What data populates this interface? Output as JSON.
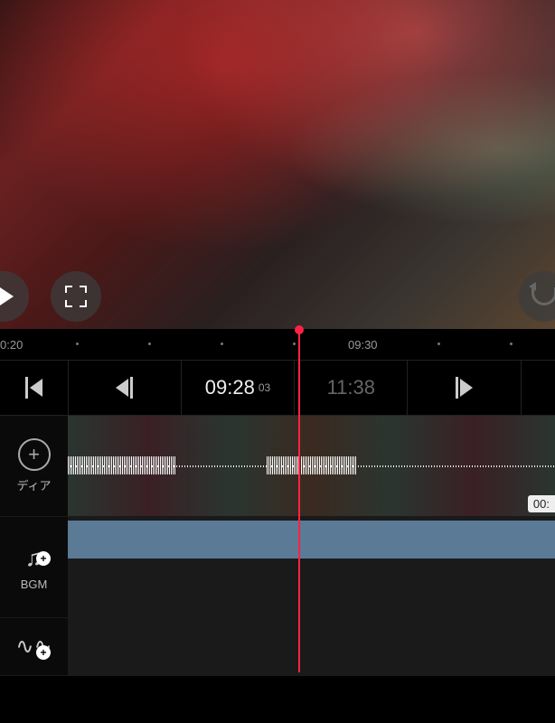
{
  "ruler": {
    "ticks": [
      "0:20",
      "09:30"
    ],
    "tick_positions": [
      0,
      385
    ]
  },
  "transport": {
    "current_time": "09:28",
    "current_frame": "03",
    "total_time": "11:38"
  },
  "tracks": {
    "media": {
      "label": "ディア",
      "clip_end_label": "00:"
    },
    "bgm": {
      "label": "BGM"
    }
  },
  "icons": {
    "play": "play-icon",
    "fullscreen": "fullscreen-icon",
    "undo": "undo-icon",
    "prev_clip": "prev-clip-icon",
    "prev_frame": "prev-frame-icon",
    "next_frame": "next-frame-icon",
    "add": "add-icon",
    "music": "music-icon",
    "audio_wave": "audio-wave-icon"
  }
}
